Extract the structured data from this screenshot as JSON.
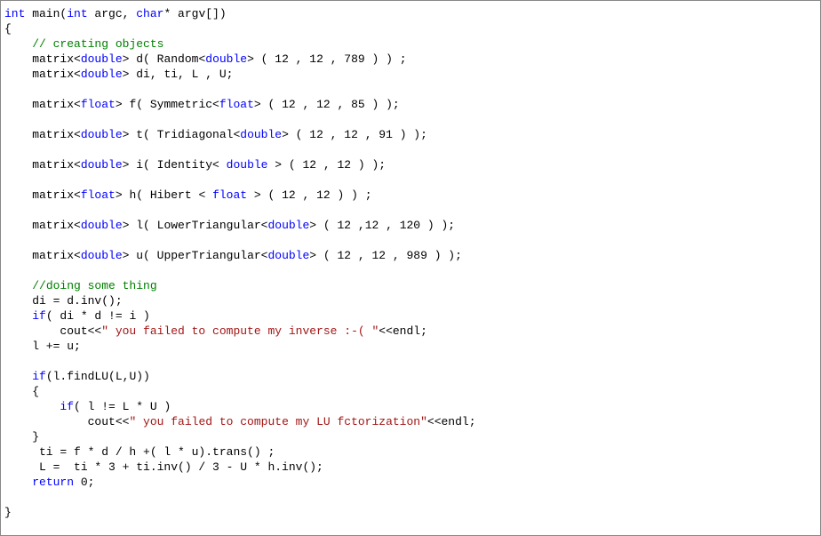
{
  "code": {
    "lines": [
      {
        "tokens": [
          {
            "t": "int",
            "c": "kw"
          },
          {
            "t": " main("
          },
          {
            "t": "int",
            "c": "kw"
          },
          {
            "t": " argc, "
          },
          {
            "t": "char",
            "c": "kw"
          },
          {
            "t": "* argv[])"
          }
        ]
      },
      {
        "tokens": [
          {
            "t": "{"
          }
        ]
      },
      {
        "tokens": [
          {
            "t": "    "
          },
          {
            "t": "// creating objects",
            "c": "cm"
          }
        ]
      },
      {
        "tokens": [
          {
            "t": "    matrix<"
          },
          {
            "t": "double",
            "c": "kw"
          },
          {
            "t": "> d( Random<"
          },
          {
            "t": "double",
            "c": "kw"
          },
          {
            "t": "> ( 12 , 12 , 789 ) ) ;"
          }
        ]
      },
      {
        "tokens": [
          {
            "t": "    matrix<"
          },
          {
            "t": "double",
            "c": "kw"
          },
          {
            "t": "> di, ti, L , U;"
          }
        ]
      },
      {
        "tokens": [
          {
            "t": ""
          }
        ]
      },
      {
        "tokens": [
          {
            "t": "    matrix<"
          },
          {
            "t": "float",
            "c": "kw"
          },
          {
            "t": "> f( Symmetric<"
          },
          {
            "t": "float",
            "c": "kw"
          },
          {
            "t": "> ( 12 , 12 , 85 ) );"
          }
        ]
      },
      {
        "tokens": [
          {
            "t": ""
          }
        ]
      },
      {
        "tokens": [
          {
            "t": "    matrix<"
          },
          {
            "t": "double",
            "c": "kw"
          },
          {
            "t": "> t( Tridiagonal<"
          },
          {
            "t": "double",
            "c": "kw"
          },
          {
            "t": "> ( 12 , 12 , 91 ) );"
          }
        ]
      },
      {
        "tokens": [
          {
            "t": ""
          }
        ]
      },
      {
        "tokens": [
          {
            "t": "    matrix<"
          },
          {
            "t": "double",
            "c": "kw"
          },
          {
            "t": "> i( Identity< "
          },
          {
            "t": "double",
            "c": "kw"
          },
          {
            "t": " > ( 12 , 12 ) );"
          }
        ]
      },
      {
        "tokens": [
          {
            "t": ""
          }
        ]
      },
      {
        "tokens": [
          {
            "t": "    matrix<"
          },
          {
            "t": "float",
            "c": "kw"
          },
          {
            "t": "> h( Hibert < "
          },
          {
            "t": "float",
            "c": "kw"
          },
          {
            "t": " > ( 12 , 12 ) ) ;"
          }
        ]
      },
      {
        "tokens": [
          {
            "t": ""
          }
        ]
      },
      {
        "tokens": [
          {
            "t": "    matrix<"
          },
          {
            "t": "double",
            "c": "kw"
          },
          {
            "t": "> l( LowerTriangular<"
          },
          {
            "t": "double",
            "c": "kw"
          },
          {
            "t": "> ( 12 ,12 , 120 ) );"
          }
        ]
      },
      {
        "tokens": [
          {
            "t": ""
          }
        ]
      },
      {
        "tokens": [
          {
            "t": "    matrix<"
          },
          {
            "t": "double",
            "c": "kw"
          },
          {
            "t": "> u( UpperTriangular<"
          },
          {
            "t": "double",
            "c": "kw"
          },
          {
            "t": "> ( 12 , 12 , 989 ) );"
          }
        ]
      },
      {
        "tokens": [
          {
            "t": ""
          }
        ]
      },
      {
        "tokens": [
          {
            "t": "    "
          },
          {
            "t": "//doing some thing",
            "c": "cm"
          }
        ]
      },
      {
        "tokens": [
          {
            "t": "    di = d.inv();"
          }
        ]
      },
      {
        "tokens": [
          {
            "t": "    "
          },
          {
            "t": "if",
            "c": "kw"
          },
          {
            "t": "( di * d != i )"
          }
        ]
      },
      {
        "tokens": [
          {
            "t": "        cout<<"
          },
          {
            "t": "\" you failed to compute my inverse :-( \"",
            "c": "str"
          },
          {
            "t": "<<endl;"
          }
        ]
      },
      {
        "tokens": [
          {
            "t": "    l += u;"
          }
        ]
      },
      {
        "tokens": [
          {
            "t": ""
          }
        ]
      },
      {
        "tokens": [
          {
            "t": "    "
          },
          {
            "t": "if",
            "c": "kw"
          },
          {
            "t": "(l.findLU(L,U))"
          }
        ]
      },
      {
        "tokens": [
          {
            "t": "    {"
          }
        ]
      },
      {
        "tokens": [
          {
            "t": "        "
          },
          {
            "t": "if",
            "c": "kw"
          },
          {
            "t": "( l != L * U )"
          }
        ]
      },
      {
        "tokens": [
          {
            "t": "            cout<<"
          },
          {
            "t": "\" you failed to compute my LU fctorization\"",
            "c": "str"
          },
          {
            "t": "<<endl;"
          }
        ]
      },
      {
        "tokens": [
          {
            "t": "    }"
          }
        ]
      },
      {
        "tokens": [
          {
            "t": "     ti = f * d / h +( l * u).trans() ;"
          }
        ]
      },
      {
        "tokens": [
          {
            "t": "     L =  ti * 3 + ti.inv() / 3 - U * h.inv();"
          }
        ]
      },
      {
        "tokens": [
          {
            "t": "    "
          },
          {
            "t": "return",
            "c": "kw"
          },
          {
            "t": " 0;"
          }
        ]
      },
      {
        "tokens": [
          {
            "t": ""
          }
        ]
      },
      {
        "tokens": [
          {
            "t": "}"
          }
        ]
      }
    ]
  }
}
